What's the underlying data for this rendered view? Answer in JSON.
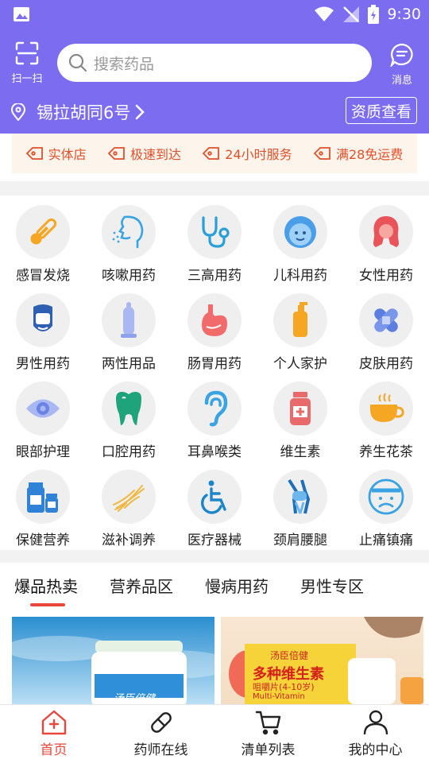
{
  "status_bar": {
    "time": "9:30"
  },
  "header": {
    "scan_label": "扫一扫",
    "search_placeholder": "搜索药品",
    "message_label": "消息",
    "location": "锡拉胡同6号",
    "qualification_button": "资质查看",
    "accent_color": "#7b6cf0"
  },
  "features": [
    "实体店",
    "极速到达",
    "24小时服务",
    "满28免运费"
  ],
  "categories": [
    {
      "label": "感冒发烧",
      "icon": "thermometer-icon"
    },
    {
      "label": "咳嗽用药",
      "icon": "cough-icon"
    },
    {
      "label": "三高用药",
      "icon": "stethoscope-icon"
    },
    {
      "label": "儿科用药",
      "icon": "baby-icon"
    },
    {
      "label": "女性用药",
      "icon": "woman-icon"
    },
    {
      "label": "男性用药",
      "icon": "man-icon"
    },
    {
      "label": "两性用品",
      "icon": "condom-icon"
    },
    {
      "label": "肠胃用药",
      "icon": "stomach-icon"
    },
    {
      "label": "个人家护",
      "icon": "lotion-bottle-icon"
    },
    {
      "label": "皮肤用药",
      "icon": "bandage-icon"
    },
    {
      "label": "眼部护理",
      "icon": "eye-icon"
    },
    {
      "label": "口腔用药",
      "icon": "tooth-icon"
    },
    {
      "label": "耳鼻喉类",
      "icon": "ear-icon"
    },
    {
      "label": "维生素",
      "icon": "vitamin-bottle-icon"
    },
    {
      "label": "养生花茶",
      "icon": "tea-cup-icon"
    },
    {
      "label": "保健营养",
      "icon": "supplement-bottles-icon"
    },
    {
      "label": "滋补调养",
      "icon": "ginseng-icon"
    },
    {
      "label": "医疗器械",
      "icon": "wheelchair-icon"
    },
    {
      "label": "颈肩腰腿",
      "icon": "knee-joint-icon"
    },
    {
      "label": "止痛镇痛",
      "icon": "pain-face-icon"
    }
  ],
  "tabs": [
    {
      "label": "爆品热卖",
      "active": true
    },
    {
      "label": "营养品区",
      "active": false
    },
    {
      "label": "慢病用药",
      "active": false
    },
    {
      "label": "男性专区",
      "active": false
    }
  ],
  "products": [
    {
      "brand": "汤臣倍健"
    },
    {
      "brand": "汤臣倍健",
      "title": "多种维生素",
      "subtitle": "咀嚼片(4-10岁)",
      "extra": "Multi-Vitamin"
    }
  ],
  "bottom_nav": [
    {
      "label": "首页",
      "icon": "home-icon",
      "active": true
    },
    {
      "label": "药师在线",
      "icon": "pill-icon",
      "active": false
    },
    {
      "label": "清单列表",
      "icon": "cart-icon",
      "active": false
    },
    {
      "label": "我的中心",
      "icon": "user-icon",
      "active": false
    }
  ],
  "colors": {
    "active": "#e8483b",
    "feature_text": "#e0502a"
  }
}
